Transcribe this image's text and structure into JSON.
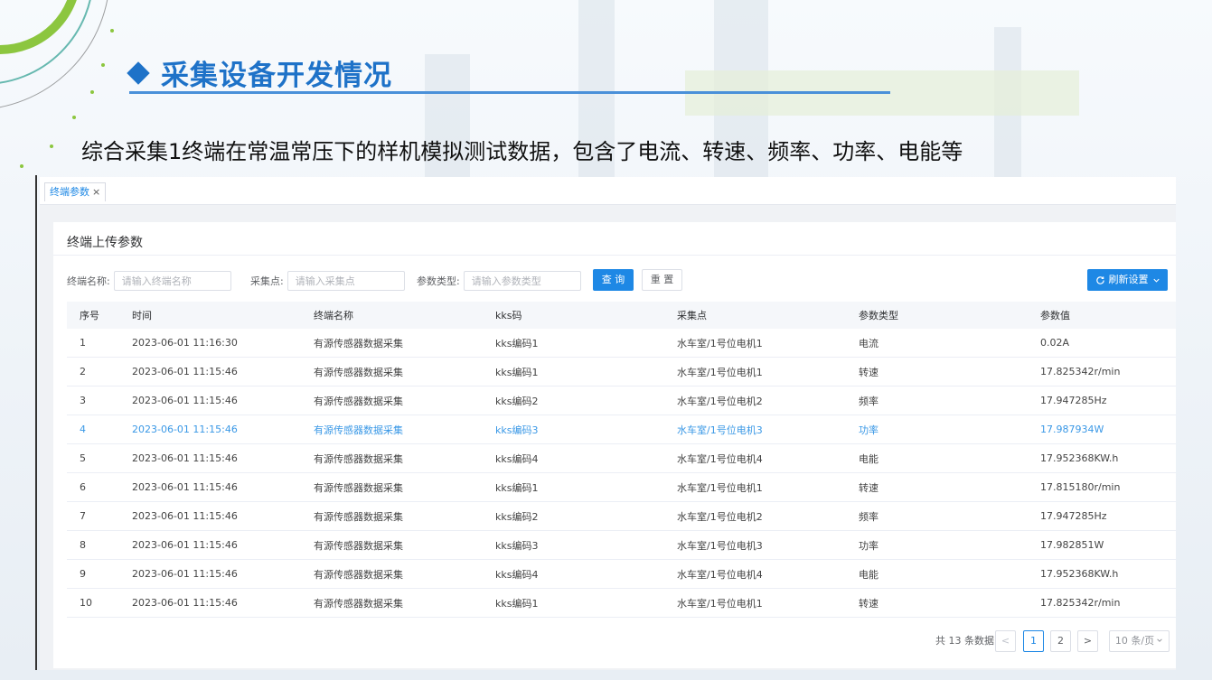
{
  "slide": {
    "title": "采集设备开发情况",
    "subtitle": "综合采集1终端在常温常压下的样机模拟测试数据，包含了电流、转速、频率、功率、电能等"
  },
  "tabs": [
    {
      "label": "终端参数",
      "close": "×"
    }
  ],
  "card": {
    "title": "终端上传参数"
  },
  "filters": {
    "terminal": {
      "label": "终端名称:",
      "placeholder": "请输入终端名称"
    },
    "point": {
      "label": "采集点:",
      "placeholder": "请输入采集点"
    },
    "param": {
      "label": "参数类型:",
      "placeholder": "请输入参数类型"
    },
    "query_label": "查 询",
    "reset_label": "重 置",
    "refresh_label": "刷新设置",
    "refresh_icon": "refresh-icon",
    "dropdown_icon": "chevron-down-icon"
  },
  "table": {
    "headers": [
      "序号",
      "时间",
      "终端名称",
      "kks码",
      "采集点",
      "参数类型",
      "参数值"
    ],
    "highlight_row": 4,
    "rows": [
      [
        "1",
        "2023-06-01 11:16:30",
        "有源传感器数据采集",
        "kks编码1",
        "水车室/1号位电机1",
        "电流",
        "0.02A"
      ],
      [
        "2",
        "2023-06-01 11:15:46",
        "有源传感器数据采集",
        "kks编码1",
        "水车室/1号位电机1",
        "转速",
        "17.825342r/min"
      ],
      [
        "3",
        "2023-06-01 11:15:46",
        "有源传感器数据采集",
        "kks编码2",
        "水车室/1号位电机2",
        "频率",
        "17.947285Hz"
      ],
      [
        "4",
        "2023-06-01 11:15:46",
        "有源传感器数据采集",
        "kks编码3",
        "水车室/1号位电机3",
        "功率",
        "17.987934W"
      ],
      [
        "5",
        "2023-06-01 11:15:46",
        "有源传感器数据采集",
        "kks编码4",
        "水车室/1号位电机4",
        "电能",
        "17.952368KW.h"
      ],
      [
        "6",
        "2023-06-01 11:15:46",
        "有源传感器数据采集",
        "kks编码1",
        "水车室/1号位电机1",
        "转速",
        "17.815180r/min"
      ],
      [
        "7",
        "2023-06-01 11:15:46",
        "有源传感器数据采集",
        "kks编码2",
        "水车室/1号位电机2",
        "频率",
        "17.947285Hz"
      ],
      [
        "8",
        "2023-06-01 11:15:46",
        "有源传感器数据采集",
        "kks编码3",
        "水车室/1号位电机3",
        "功率",
        "17.982851W"
      ],
      [
        "9",
        "2023-06-01 11:15:46",
        "有源传感器数据采集",
        "kks编码4",
        "水车室/1号位电机4",
        "电能",
        "17.952368KW.h"
      ],
      [
        "10",
        "2023-06-01 11:15:46",
        "有源传感器数据采集",
        "kks编码1",
        "水车室/1号位电机1",
        "转速",
        "17.825342r/min"
      ]
    ]
  },
  "pagination": {
    "total_text": "共 13 条数据",
    "prev": "<",
    "pages": [
      "1",
      "2"
    ],
    "current": "1",
    "next": ">",
    "page_size": "10 条/页"
  },
  "colors": {
    "accent": "#1e72c8",
    "primary_button": "#1e88e5",
    "highlight_text": "#3a98e6",
    "deco_green": "#8cc63f"
  }
}
